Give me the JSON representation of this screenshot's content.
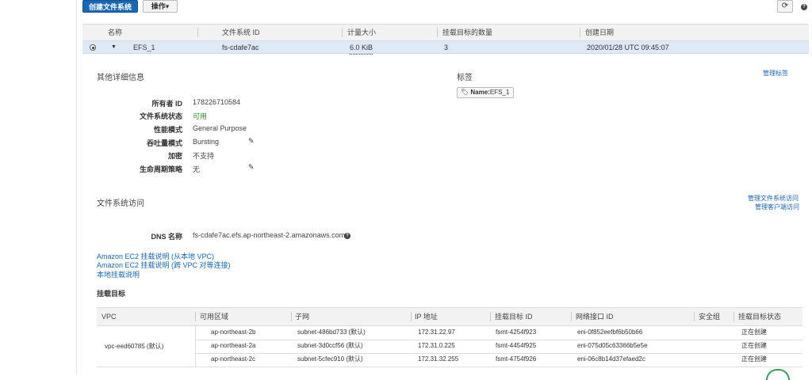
{
  "toolbar": {
    "create_label": "创建文件系统",
    "actions_label": "操作▾",
    "refresh_glyph": "⟳",
    "help_glyph": "?"
  },
  "fs_table": {
    "columns": [
      "名称",
      "文件系统 ID",
      "计量大小",
      "挂载目标的数量",
      "创建日期"
    ],
    "row": {
      "name": "EFS_1",
      "id": "fs-cdafe7ac",
      "size": "6.0 KiB",
      "mount_count": "3",
      "created": "2020/01/28 UTC 09:45:07"
    }
  },
  "details": {
    "title": "其他详细信息",
    "owner_label": "所有者 ID",
    "owner_value": "178226710584",
    "state_label": "文件系统状态",
    "state_value": "可用",
    "perf_label": "性能模式",
    "perf_value": "General Purpose",
    "throughput_label": "吞吐量模式",
    "throughput_value": "Bursting",
    "encrypt_label": "加密",
    "encrypt_value": "不支持",
    "lifecycle_label": "生命周期策略",
    "lifecycle_value": "无"
  },
  "tags": {
    "title": "标签",
    "manage_label": "管理标签",
    "tag_key": "Name:",
    "tag_value": "EFS_1"
  },
  "access": {
    "title": "文件系统访问",
    "manage_access_label": "管理文件系统访问",
    "manage_client_label": "管理客户端访问",
    "dns_label": "DNS 名称",
    "dns_value": "fs-cdafe7ac.efs.ap-northeast-2.amazonaws.com",
    "link1": "Amazon EC2 挂载说明 (从本地 VPC)",
    "link2": "Amazon EC2 挂载说明 (跨 VPC 对等连接)",
    "link3": "本地挂载说明",
    "mount_targets_title": "挂载目标"
  },
  "mount_targets": {
    "columns": [
      "VPC",
      "可用区域",
      "子网",
      "IP 地址",
      "挂载目标 ID",
      "网络接口 ID",
      "安全组",
      "挂载目标状态"
    ],
    "vpc": "vpc-eed60785 (默认)",
    "rows": [
      {
        "az": "ap-northeast-2b",
        "subnet": "subnet-486bd733 (默认)",
        "ip": "172.31.22.97",
        "mt_id": "fsmt-4254f923",
        "eni": "eni-0f852eefbf6b50b66",
        "status": "正在创建"
      },
      {
        "az": "ap-northeast-2a",
        "subnet": "subnet-3d0ccf56 (默认)",
        "ip": "172.31.0.225",
        "mt_id": "fsmt-4454f925",
        "eni": "eni-075d05c63366b5e5e",
        "status": "正在创建"
      },
      {
        "az": "ap-northeast-2c",
        "subnet": "subnet-5cfec910 (默认)",
        "ip": "172.31.32.255",
        "mt_id": "fsmt-4754f926",
        "eni": "eni-06c8b14d37efaed2c",
        "status": "正在创建"
      }
    ]
  },
  "colors": {
    "primary": "#1a67b4",
    "link": "#1a67b4",
    "available": "#2a8a2a",
    "creating": "#e07b00",
    "selected_row": "#dde9f5"
  }
}
